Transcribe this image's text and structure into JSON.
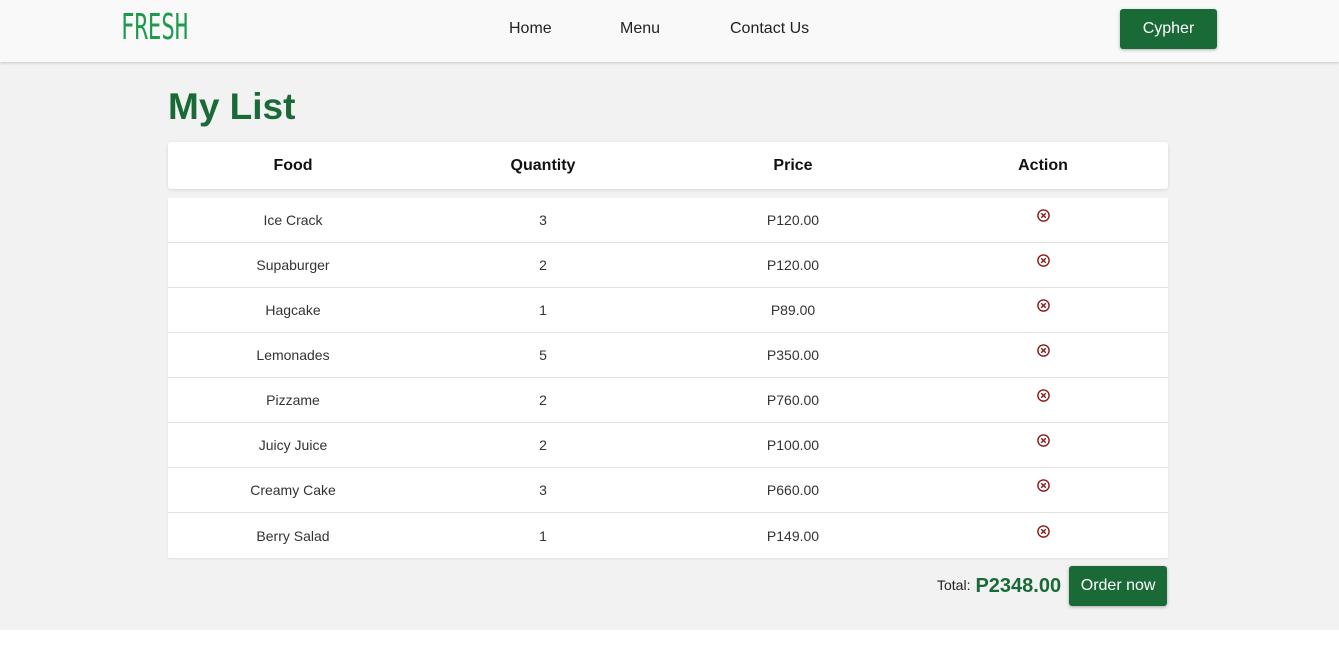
{
  "nav": {
    "logo": "FRESH",
    "links": [
      "Home",
      "Menu",
      "Contact Us"
    ],
    "user": "Cypher"
  },
  "page": {
    "title": "My List"
  },
  "table": {
    "columns": [
      "Food",
      "Quantity",
      "Price",
      "Action"
    ],
    "action_icon": "remove-circle-icon",
    "rows": [
      {
        "food": "Ice Crack",
        "quantity": "3",
        "price": "P120.00"
      },
      {
        "food": "Supaburger",
        "quantity": "2",
        "price": "P120.00"
      },
      {
        "food": "Hagcake",
        "quantity": "1",
        "price": "P89.00"
      },
      {
        "food": "Lemonades",
        "quantity": "5",
        "price": "P350.00"
      },
      {
        "food": "Pizzame",
        "quantity": "2",
        "price": "P760.00"
      },
      {
        "food": "Juicy Juice",
        "quantity": "2",
        "price": "P100.00"
      },
      {
        "food": "Creamy Cake",
        "quantity": "3",
        "price": "P660.00"
      },
      {
        "food": "Berry Salad",
        "quantity": "1",
        "price": "P149.00"
      }
    ]
  },
  "summary": {
    "total_label": "Total:",
    "total_value": "P2348.00",
    "order_label": "Order now"
  },
  "colors": {
    "brand": "#196a36",
    "logo": "#1e9a4f",
    "remove_icon": "#8b1a1a",
    "background": "#f2f2f2"
  }
}
